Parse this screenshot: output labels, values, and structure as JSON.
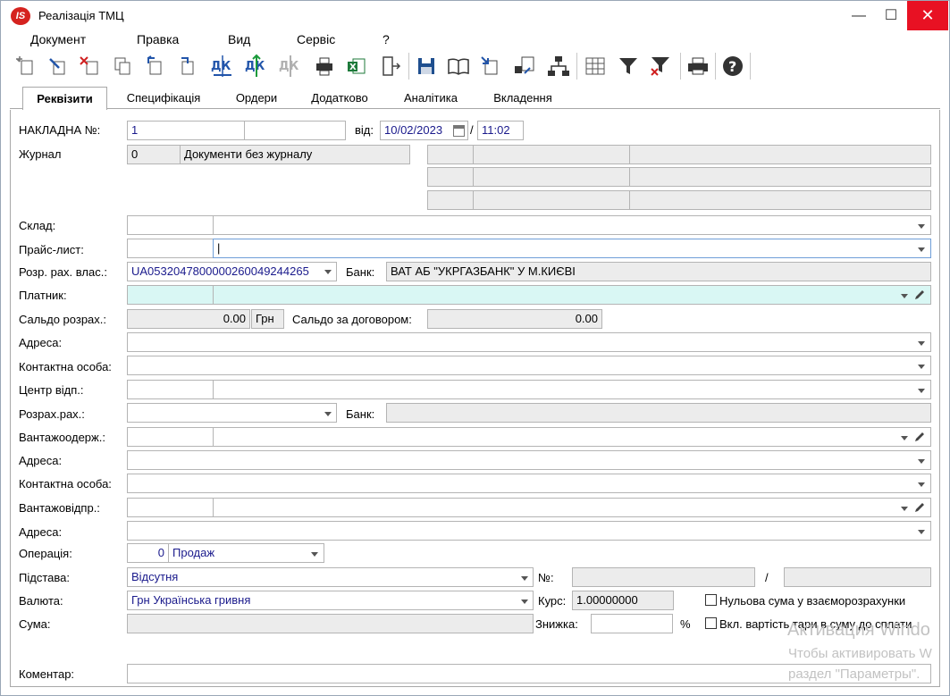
{
  "window": {
    "title": "Реалізація ТМЦ",
    "app_icon_text": "IS",
    "controls": {
      "minimize": "—",
      "maximize": "☐",
      "close": "✕"
    }
  },
  "menu": [
    "Документ",
    "Правка",
    "Вид",
    "Сервіс",
    "?"
  ],
  "toolbar_icons": [
    "new-doc-icon",
    "edit-doc-icon",
    "delete-doc-icon",
    "copy-doc-icon",
    "undo-doc-icon",
    "redo-doc-icon",
    "debit-credit-icon",
    "debit-credit-green-icon",
    "debit-credit-disabled-icon",
    "print-preview-icon",
    "export-excel-icon",
    "exit-door-icon",
    "save-icon",
    "book-icon",
    "doc-link-icon",
    "doc-arrow-icon",
    "hierarchy-icon",
    "grid-icon",
    "filter-icon",
    "clear-filter-icon",
    "printer-icon",
    "help-icon"
  ],
  "tabs": [
    "Реквізити",
    "Специфікація",
    "Ордери",
    "Додатково",
    "Аналітика",
    "Вкладення"
  ],
  "active_tab": "Реквізити",
  "form": {
    "invoice_label": "НАКЛАДНА №:",
    "invoice_number": "1",
    "from_label": "від:",
    "date": "10/02/2023",
    "date_time_sep": "/",
    "time": "11:02",
    "journal_label": "Журнал",
    "journal_code": "0",
    "journal_name": "Документи без журналу",
    "warehouse_label": "Склад:",
    "pricelist_label": "Прайс-лист:",
    "pricelist_value": "|",
    "own_account_label": "Розр. рах. влас.:",
    "own_account": "UA053204780000026004924426​5",
    "bank_label": "Банк:",
    "bank_value": "ВАТ АБ \"УКРГАЗБАНК\" У М.КИЄВІ",
    "payer_label": "Платник:",
    "balance_label": "Сальдо розрах.:",
    "balance_value": "0.00",
    "currency_short": "Грн",
    "contract_balance_label": "Сальдо за договором:",
    "contract_balance_value": "0.00",
    "address_label": "Адреса:",
    "contact_label": "Контактна особа:",
    "center_label": "Центр відп.:",
    "settle_account_label": "Розрах.рах.:",
    "bank2_label": "Банк:",
    "consignee_label": "Вантажоодерж.:",
    "address2_label": "Адреса:",
    "contact2_label": "Контактна особа:",
    "shipper_label": "Вантажовідпр.:",
    "address3_label": "Адреса:",
    "operation_label": "Операція:",
    "operation_code": "0",
    "operation_name": "Продаж",
    "basis_label": "Підстава:",
    "basis_value": "Відсутня",
    "no_label": "№:",
    "slash": "/",
    "currency_label": "Валюта:",
    "currency_value": "Грн Українська гривня",
    "rate_label": "Курс:",
    "rate_value": "1.00000000",
    "zero_sum_label": "Нульова сума у взаєморозрахунки",
    "sum_label": "Сума:",
    "discount_label": "Знижка:",
    "percent": "%",
    "tare_label": "Вкл. вартість тари в суму до сплати",
    "comment_label": "Коментар:"
  },
  "watermark": {
    "line1": "Активация Windo",
    "line2": "Чтобы активировать W",
    "line3": "раздел \"Параметры\"."
  }
}
